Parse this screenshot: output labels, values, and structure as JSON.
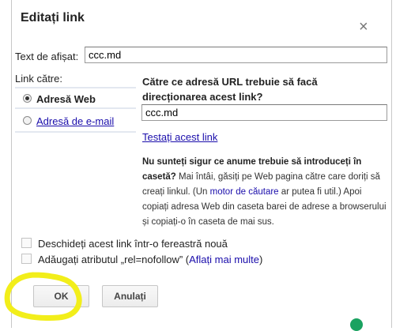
{
  "dialog": {
    "title": "Editați link",
    "close_glyph": "×"
  },
  "text_field": {
    "label": "Text de afișat:",
    "value": "ccc.md"
  },
  "link_to": {
    "label": "Link către:",
    "options": [
      {
        "label": "Adresă Web",
        "selected": true
      },
      {
        "label": "Adresă de e-mail",
        "selected": false
      }
    ]
  },
  "url_section": {
    "question": "Către ce adresă URL trebuie să facă direcționarea acest link?",
    "value": "ccc.md",
    "test_link": "Testați acest link"
  },
  "help": {
    "bold": "Nu sunteți sigur ce anume trebuie să introduceți în casetă?",
    "part1": " Mai întâi, găsiți pe Web pagina către care doriți să creați linkul. (Un ",
    "link": "motor de căutare",
    "part2": " ar putea fi util.) Apoi copiați adresa Web din caseta barei de adrese a browserului și copiați-o în caseta de mai sus."
  },
  "checkboxes": [
    {
      "label": "Deschideți acest link într-o fereastră nouă",
      "checked": false
    },
    {
      "label_prefix": "Adăugați atributul „rel=nofollow” (",
      "link": "Aflați mai multe",
      "label_suffix": ")",
      "checked": false
    }
  ],
  "buttons": {
    "ok": "OK",
    "cancel": "Anulați"
  },
  "colors": {
    "link": "#1a0dab",
    "highlight": "#f2ee1a"
  }
}
